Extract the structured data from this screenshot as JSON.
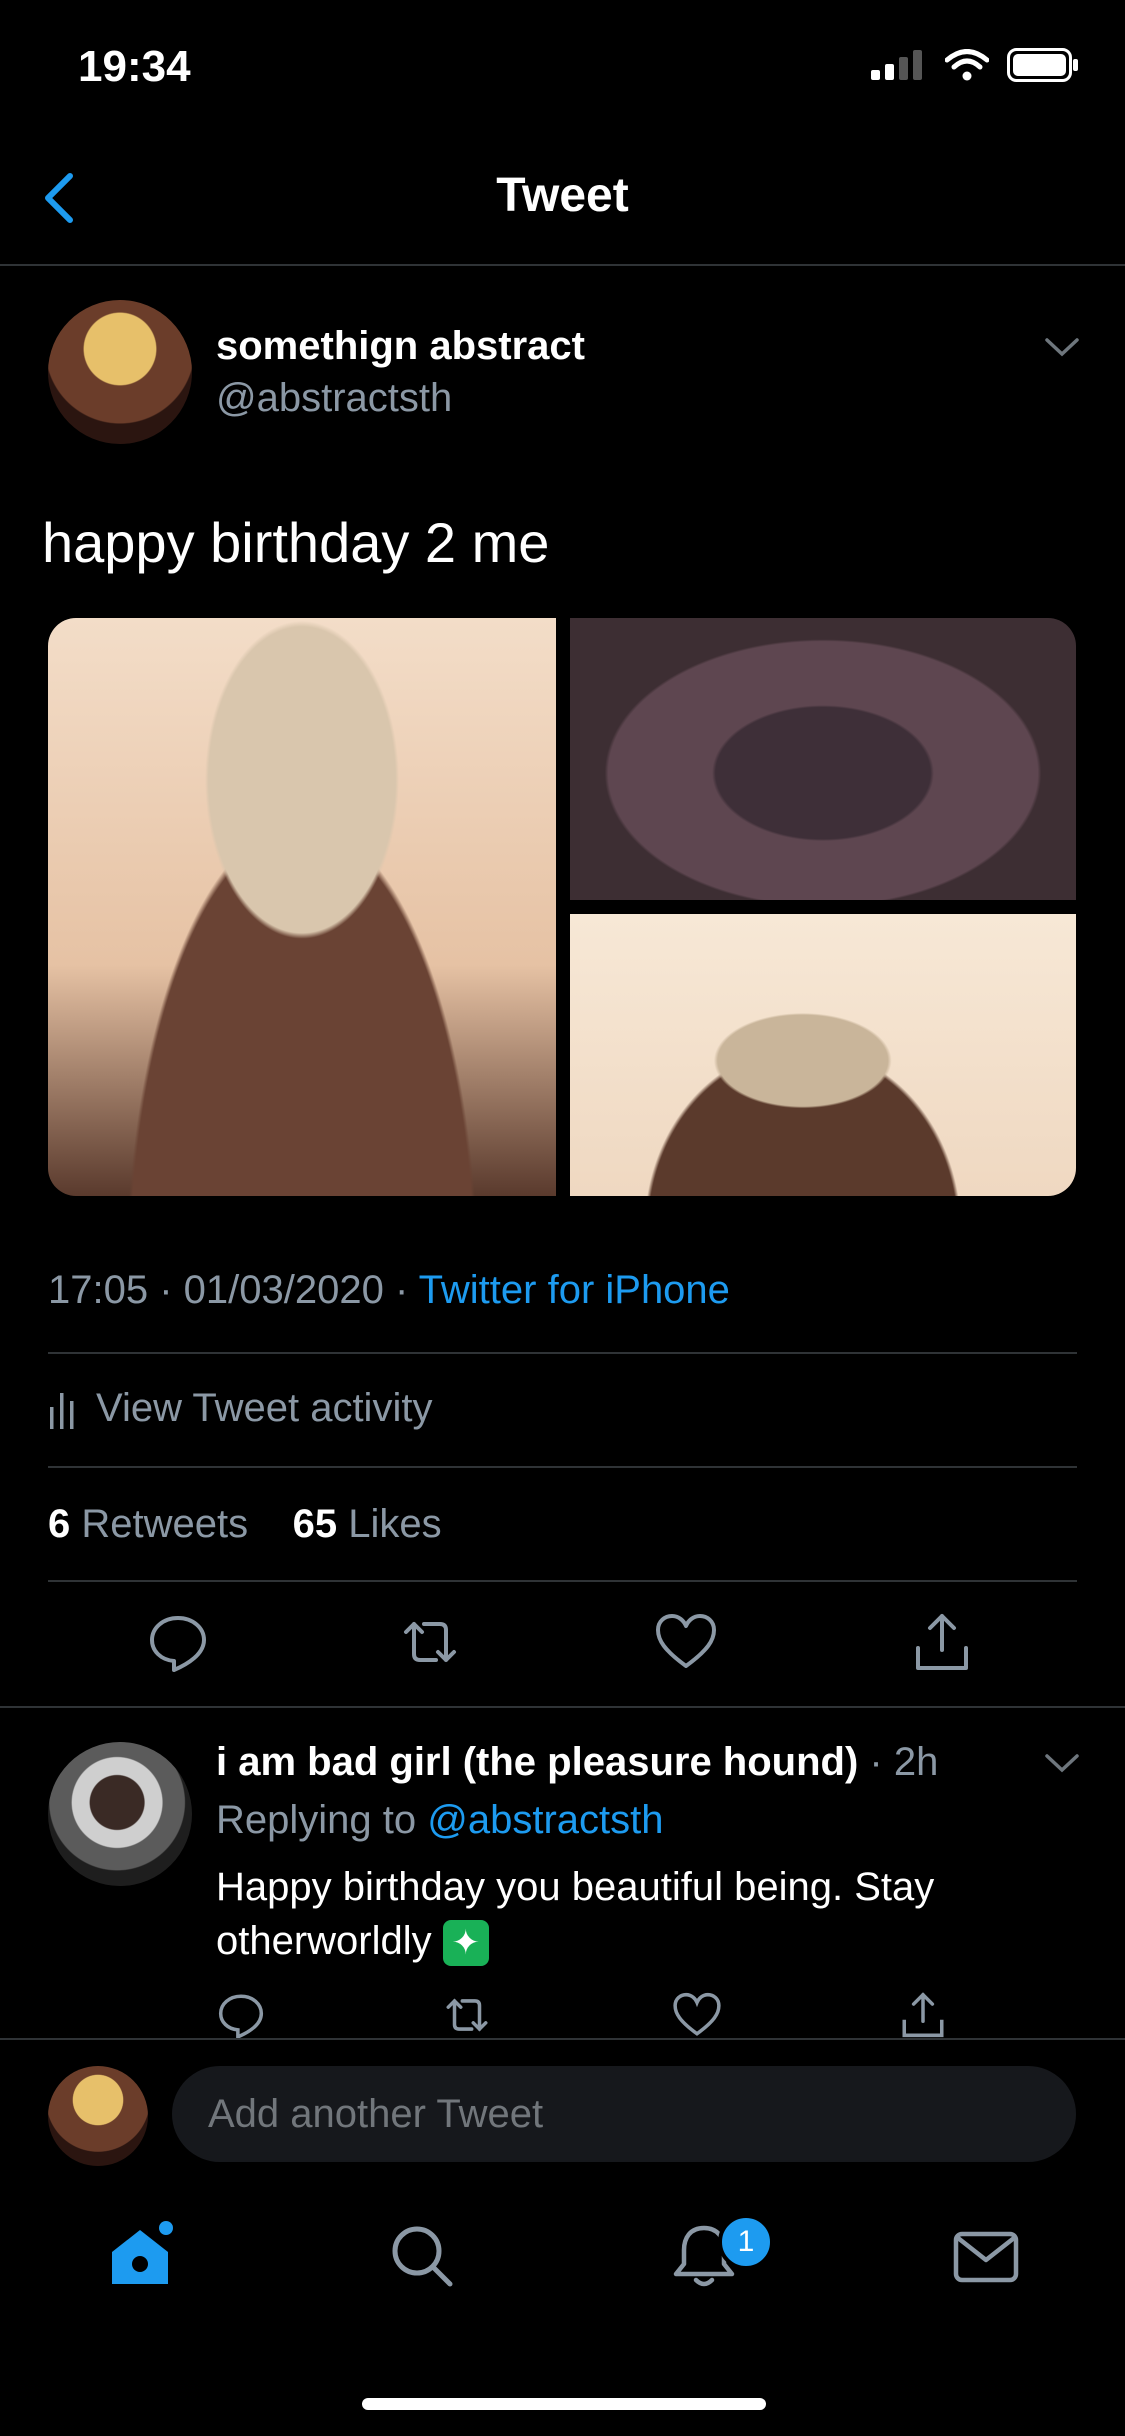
{
  "status_bar": {
    "time": "19:34"
  },
  "header": {
    "title": "Tweet"
  },
  "tweet": {
    "author_name": "somethign abstract",
    "author_handle": "@abstractsth",
    "text": "happy birthday 2 me",
    "timestamp": "17:05 · 01/03/2020 · ",
    "source": "Twitter for iPhone",
    "activity_label": "View Tweet activity",
    "retweets_count": "6",
    "retweets_label": "Retweets",
    "likes_count": "65",
    "likes_label": "Likes"
  },
  "reply": {
    "author_name": "i am bad girl (the pleasure hound)",
    "time": " · 2h",
    "replying_label": "Replying to ",
    "replying_handle": "@abstractsth",
    "text": "Happy birthday you beautiful being. Stay otherworldly"
  },
  "compose": {
    "placeholder": "Add another Tweet"
  },
  "tabbar": {
    "notifications_badge": "1"
  },
  "colors": {
    "accent": "#1d9bf0",
    "background": "#000000",
    "muted": "#8b98a5"
  },
  "icons": [
    "back-chevron-icon",
    "signal-icon",
    "wifi-icon",
    "battery-icon",
    "chevron-down-icon",
    "activity-icon",
    "reply-icon",
    "retweet-icon",
    "like-icon",
    "share-icon",
    "home-icon",
    "search-icon",
    "notifications-icon",
    "messages-icon"
  ]
}
